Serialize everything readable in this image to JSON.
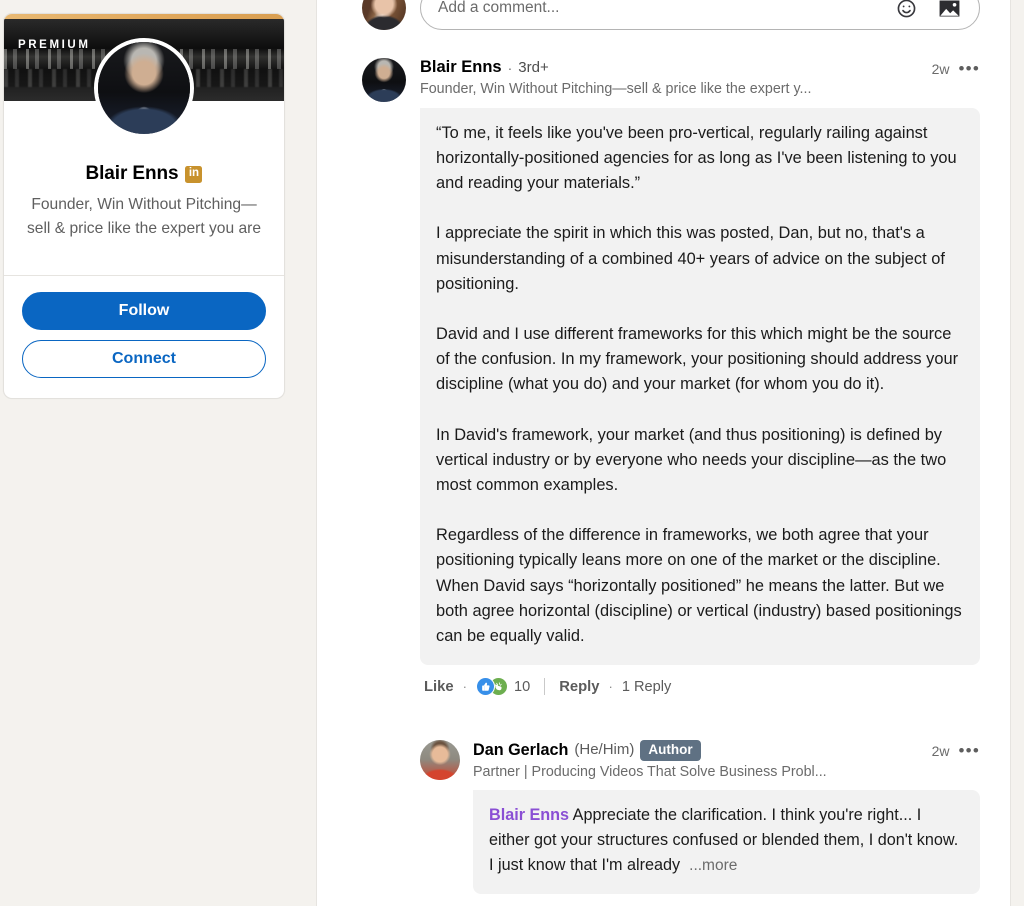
{
  "theme": {
    "page_bg": "#f4f2ee",
    "card_bg": "#ffffff",
    "bubble_bg": "#f2f2f2",
    "linkedin_blue": "#0a66c2",
    "premium_gold": "#c8922d",
    "author_badge_bg": "#5f7183",
    "mention_purple": "#8a4fd4",
    "reaction_like_blue": "#378fe9",
    "reaction_clap_green": "#6dae4f"
  },
  "profile_card": {
    "premium_label": "PREMIUM",
    "name": "Blair Enns",
    "premium_badge_text": "in",
    "headline": "Founder, Win Without Pitching—sell & price like the expert you are",
    "follow_label": "Follow",
    "connect_label": "Connect"
  },
  "compose": {
    "placeholder": "Add a comment...",
    "emoji_icon": "emoji-icon",
    "image_icon": "image-icon"
  },
  "comment": {
    "author_name": "Blair Enns",
    "separator": "·",
    "degree": "3rd+",
    "headline": "Founder, Win Without Pitching—sell & price like the expert y...",
    "timestamp": "2w",
    "more_glyph": "•••",
    "paragraphs": [
      "“To me, it feels like you've been pro-vertical, regularly railing against horizontally-positioned agencies for as long as I've been listening to you and reading your materials.”",
      "I appreciate the spirit in which this was posted, Dan, but no, that's a misunderstanding of a combined 40+ years of advice on the subject of positioning.",
      "David and I use different frameworks for this which might be the source of the confusion. In my framework, your positioning should address your discipline (what you do) and your market (for whom you do it).",
      "In David's framework, your market (and thus positioning) is defined by vertical industry or by everyone who needs your discipline—as the two most common examples.",
      "Regardless of the difference in frameworks, we both agree that your positioning typically leans more on one of the market or the discipline. When David says “horizontally positioned” he means the latter. But we both agree horizontal (discipline) or vertical (industry) based positionings can be equally valid."
    ],
    "actions": {
      "like_label": "Like",
      "dot": "·",
      "reaction_count": "10",
      "reply_label": "Reply",
      "reply_count_label": "1 Reply"
    }
  },
  "reply": {
    "author_name": "Dan Gerlach",
    "pronouns": "(He/Him)",
    "author_badge": "Author",
    "headline": "Partner | Producing Videos That Solve Business Probl...",
    "timestamp": "2w",
    "more_glyph": "•••",
    "mention": "Blair Enns",
    "body": " Appreciate the clarification. I think you're right... I either got your structures confused or blended them, I don't know. I just know that I'm already",
    "see_more_label": "...more"
  }
}
